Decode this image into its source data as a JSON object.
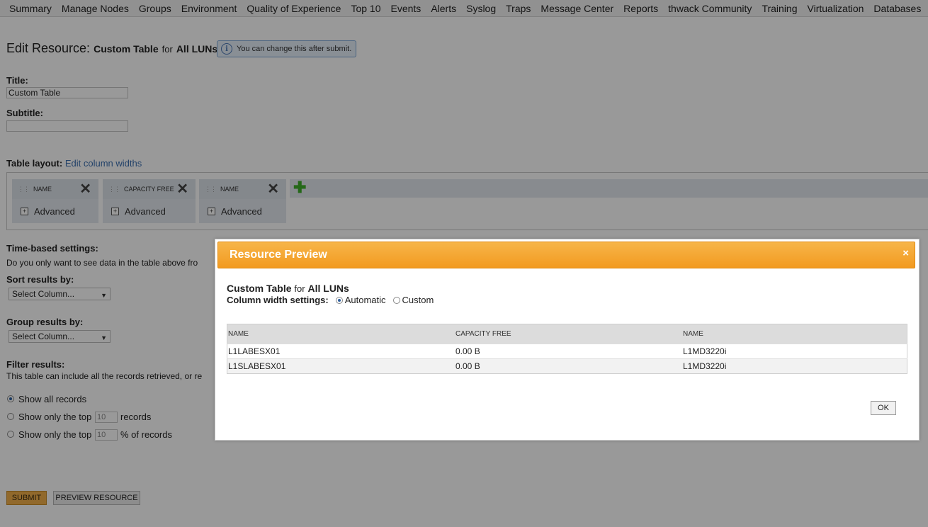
{
  "nav": [
    "Summary",
    "Manage Nodes",
    "Groups",
    "Environment",
    "Quality of Experience",
    "Top 10",
    "Events",
    "Alerts",
    "Syslog",
    "Traps",
    "Message Center",
    "Reports",
    "thwack Community",
    "Training",
    "Virtualization",
    "Databases"
  ],
  "heading": {
    "prefix": "Edit Resource:",
    "title": "Custom Table",
    "for": "for",
    "scope": "All LUNs",
    "hint": "You can change this after submit."
  },
  "form": {
    "title_label": "Title:",
    "title_value": "Custom Table",
    "subtitle_label": "Subtitle:",
    "subtitle_value": "",
    "layout_label": "Table layout:",
    "layout_link": "Edit column widths",
    "columns": [
      {
        "name": "NAME",
        "advanced": "Advanced"
      },
      {
        "name": "CAPACITY FREE",
        "advanced": "Advanced"
      },
      {
        "name": "NAME",
        "advanced": "Advanced"
      }
    ],
    "time_label": "Time-based settings:",
    "time_text": "Do you only want to see data in the table above fro",
    "sort_label": "Sort results by:",
    "sort_value": "Select Column...",
    "group_label": "Group results by:",
    "group_value": "Select Column...",
    "filter_label": "Filter results:",
    "filter_text": "This table can include all the records retrieved, or re",
    "filter_all": "Show all records",
    "filter_top_pre": "Show only the top",
    "filter_top_n": "10",
    "filter_top_post": "records",
    "filter_pct_pre": "Show only the top",
    "filter_pct_n": "10",
    "filter_pct_post": "% of records",
    "submit": "SUBMIT",
    "preview": "PREVIEW RESOURCE"
  },
  "dialog": {
    "title": "Resource Preview",
    "close": "×",
    "res_title": "Custom Table",
    "res_for": "for",
    "res_scope": "All LUNs",
    "width_label": "Column width settings:",
    "opt_auto": "Automatic",
    "opt_custom": "Custom",
    "headers": [
      "NAME",
      "CAPACITY FREE",
      "NAME"
    ],
    "rows": [
      [
        "L1LABESX01",
        "0.00 B",
        "L1MD3220i"
      ],
      [
        "L1SLABESX01",
        "0.00 B",
        "L1MD3220i"
      ]
    ],
    "ok": "OK"
  }
}
